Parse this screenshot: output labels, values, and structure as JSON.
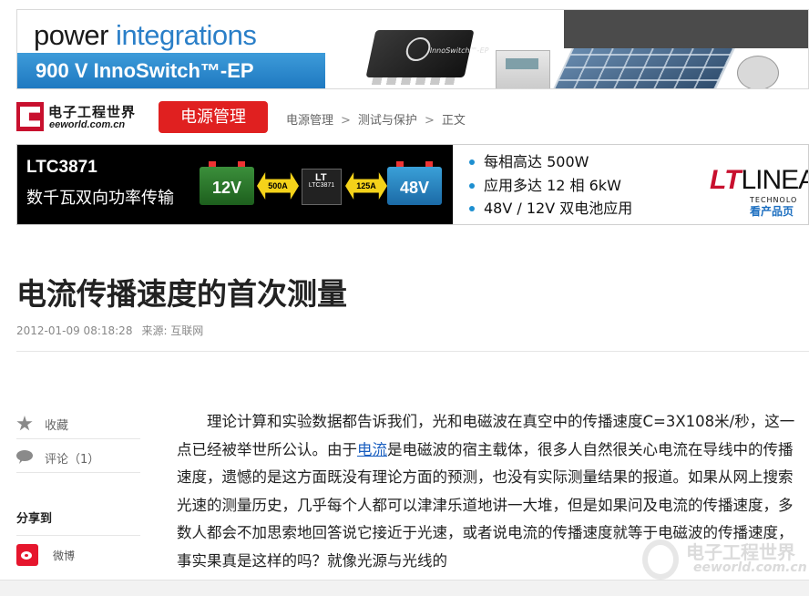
{
  "top_banner": {
    "logo_word1": "power",
    "logo_word2": " integrations",
    "tagline": "900 V InnoSwitch™-EP",
    "chip_text": "InnoSwitch™-EP"
  },
  "site": {
    "logo_cn": "电子工程世界",
    "logo_en": "eeworld.com.cn",
    "channel": "电源管理"
  },
  "breadcrumb": {
    "items": [
      "电源管理",
      "测试与保护",
      "正文"
    ],
    "separator": ">"
  },
  "ad_banner": {
    "model": "LTC3871",
    "subtitle": "数千瓦双向功率传输",
    "battery_left": "12V",
    "arrow_left": "500A",
    "chip_brand": "LT",
    "chip_label": "LTC3871",
    "arrow_right": "125A",
    "battery_right": "48V",
    "bullets": [
      "每相高达 500W",
      "应用多达 12 相 6kW",
      "48V / 12V 双电池应用"
    ],
    "brand_name": "LINEA",
    "brand_sub": "TECHNOLO",
    "cta": "看产品页"
  },
  "article": {
    "title": "电流传播速度的首次测量",
    "date": "2012-01-09 08:18:28",
    "source": "来源: 互联网",
    "body_1": "理论计算和实验数据都告诉我们，光和电磁波在真空中的传播速度C=3X108米/秒，这一点已经被举世所公认。由于",
    "body_link": "电流",
    "body_2": "是电磁波的宿主载体，很多人自然很关心电流在导线中的传播速度，遗憾的是这方面既没有理论方面的预测，也没有实际测量结果的报道。如果从网上搜索光速的测量历史，几乎每个人都可以津津乐道地讲一大堆，但是如果问及电流的传播速度，多数人都会不加思索地回答说它接近于光速，或者说电流的传播速度就等于电磁波的传播速度，事实果真是这样的吗？就像光源与光线的"
  },
  "sidebar": {
    "favorite": "收藏",
    "comments": "评论（1）",
    "share_title": "分享到",
    "weibo": "微博"
  },
  "watermark": {
    "big": "电子工程世界",
    "small": "eeworld.com.cn"
  },
  "colors": {
    "accent_red": "#e02020",
    "link_blue": "#1a5fc0",
    "brand_blue": "#2a7fc8"
  },
  "icons": [
    "star-icon",
    "comment-icon",
    "weibo-icon"
  ]
}
